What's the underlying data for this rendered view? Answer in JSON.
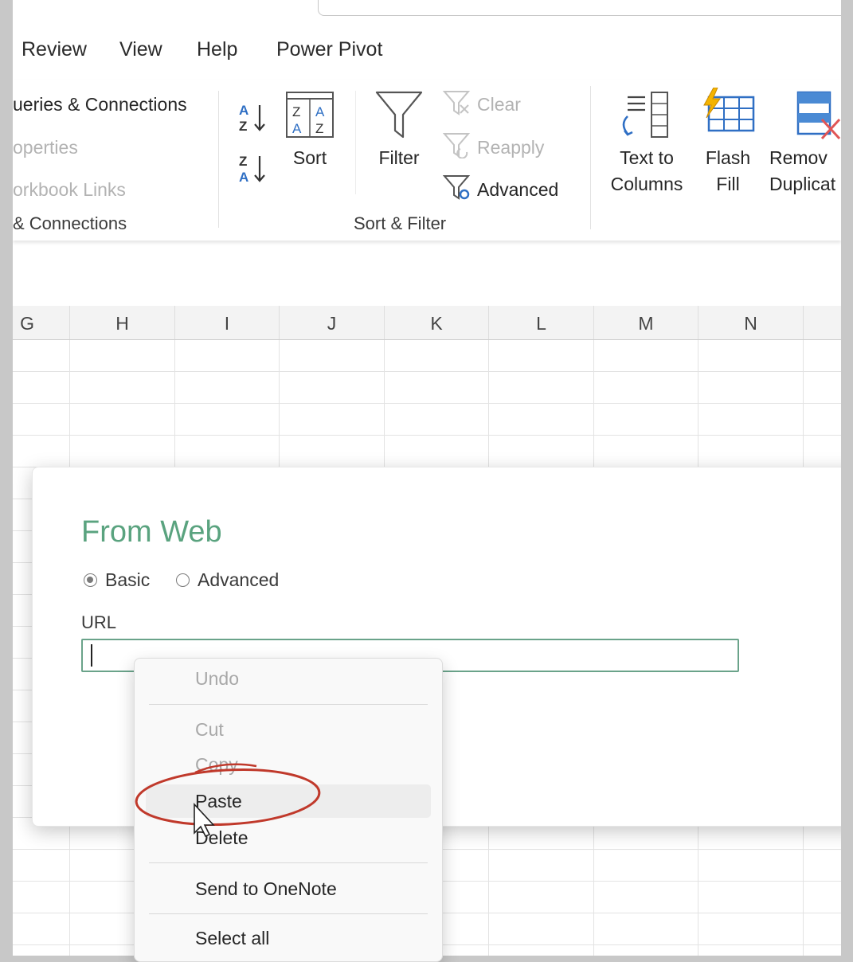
{
  "ribbon_tabs": [
    "Review",
    "View",
    "Help",
    "Power Pivot"
  ],
  "queries_group": {
    "items": [
      "ueries & Connections",
      "operties",
      "orkbook Links"
    ],
    "label": "& Connections"
  },
  "sort_filter_group": {
    "sort_label": "Sort",
    "filter_label": "Filter",
    "clear_label": "Clear",
    "reapply_label": "Reapply",
    "advanced_label": "Advanced",
    "label": "Sort & Filter"
  },
  "data_tools": {
    "text_to_columns": "Text to\nColumns",
    "flash_fill": "Flash\nFill",
    "remove_duplicates": "Remov\nDuplicat"
  },
  "columns": [
    "G",
    "H",
    "I",
    "J",
    "K",
    "L",
    "M",
    "N"
  ],
  "dialog": {
    "title": "From Web",
    "radio_basic": "Basic",
    "radio_advanced": "Advanced",
    "url_label": "URL",
    "url_value": ""
  },
  "context_menu": {
    "undo": "Undo",
    "cut": "Cut",
    "copy": "Copy",
    "paste": "Paste",
    "delete": "Delete",
    "send_onenote": "Send to OneNote",
    "select_all": "Select all"
  },
  "colors": {
    "dialog_accent": "#5aa37f",
    "annotation": "#c0392b"
  }
}
